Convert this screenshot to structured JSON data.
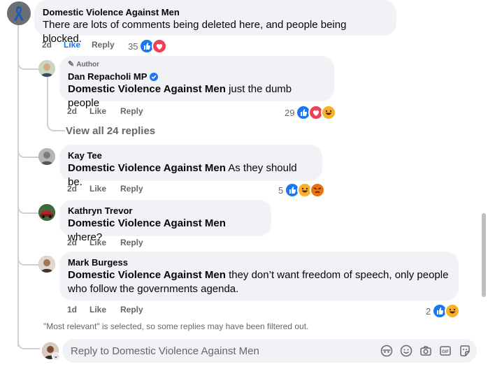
{
  "comment_top": {
    "author": "Domestic Violence Against Men",
    "text": "There are lots of comments being deleted here, and people being blocked.",
    "time": "2d",
    "like": "Like",
    "reply": "Reply",
    "reactions": "35",
    "reaction_icons": [
      "like-icon",
      "love-icon"
    ]
  },
  "reply1": {
    "badge": "Author",
    "author": "Dan Repacholi MP",
    "verified_icon": "verified-badge-icon",
    "tag": "Domestic Violence Against Men",
    "text": " just the dumb people",
    "time": "2d",
    "like": "Like",
    "reply": "Reply",
    "reactions": "29",
    "reaction_icons": [
      "like-icon",
      "love-icon",
      "haha-icon"
    ]
  },
  "view_all": "View all 24 replies",
  "reply2": {
    "author": "Kay Tee",
    "tag": "Domestic Violence Against Men",
    "text": " As they should be.",
    "time": "2d",
    "like": "Like",
    "reply": "Reply",
    "reactions": "5",
    "reaction_icons": [
      "like-icon",
      "haha-icon",
      "angry-icon"
    ]
  },
  "reply3": {
    "author": "Kathryn Trevor",
    "tag": "Domestic Violence Against Men",
    "text": " where?",
    "time": "2d",
    "like": "Like",
    "reply": "Reply"
  },
  "reply4": {
    "author": "Mark Burgess",
    "tag": "Domestic Violence Against Men",
    "text": " they don’t want freedom of speech, only people who follow the governments agenda.",
    "time": "1d",
    "like": "Like",
    "reply": "Reply",
    "reactions": "2",
    "reaction_icons": [
      "like-icon",
      "haha-icon"
    ]
  },
  "filter_notice": "\"Most relevant\" is selected, so some replies may have been filtered out.",
  "reply_input": {
    "placeholder": "Reply to Domestic Violence Against Men",
    "icons": [
      "avatar-sticker-icon",
      "emoji-icon",
      "camera-icon",
      "gif-icon",
      "sticker-icon"
    ]
  },
  "colors": {
    "like_blue": "#1877f2",
    "love_red": "#f33e58",
    "haha_yellow": "#f7b125",
    "angry_orange": "#e9710f",
    "link_blue": "#1877f2",
    "bubble_bg": "#f0f2f5",
    "meta_gray": "#65676b"
  }
}
